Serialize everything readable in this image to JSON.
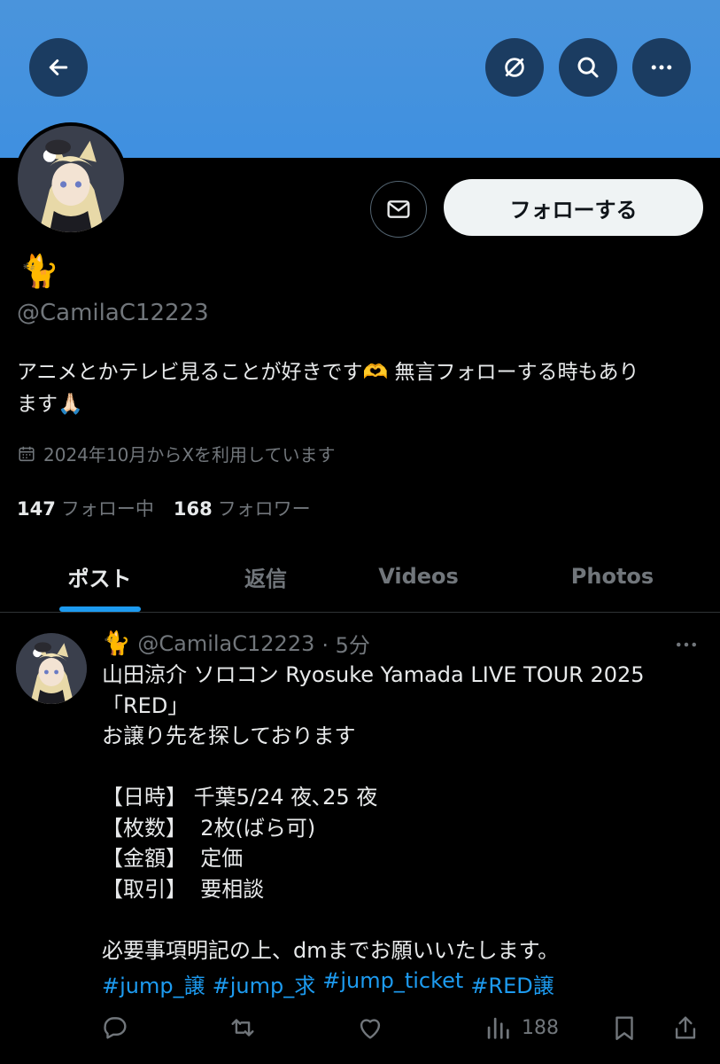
{
  "header": {
    "back_icon": "arrow-left-icon",
    "grok_icon": "slash-circle-icon",
    "search_icon": "search-icon",
    "more_icon": "more-horizontal-icon"
  },
  "profile": {
    "display_name_emoji": "🐈",
    "handle": "@CamilaC12223",
    "bio_line1": "アニメとかテレビ見ることが好きです🫶 無言フォローする時もあり",
    "bio_line2": "ます🙏🏻",
    "joined": "2024年10月からXを利用しています",
    "following_count": "147",
    "following_label": "フォロー中",
    "followers_count": "168",
    "followers_label": "フォロワー",
    "follow_button": "フォローする",
    "message_icon": "envelope-icon"
  },
  "tabs": [
    {
      "label": "ポスト",
      "active": true
    },
    {
      "label": "返信",
      "active": false
    },
    {
      "label": "Videos",
      "active": false
    },
    {
      "label": "Photos",
      "active": false
    }
  ],
  "post": {
    "author_emoji": "🐈",
    "handle": "@CamilaC12223",
    "time": "· 5分",
    "body": "山田涼介 ソロコン Ryosuke Yamada LIVE TOUR 2025\n「RED」\nお譲り先を探しております\n\n【日時】 千葉5/24 夜､25 夜\n【枚数】  2枚(ばら可)\n【金額】  定価\n【取引】  要相談\n\n必要事項明記の上、dmまでお願いいたします。",
    "hashtags": [
      "#jump_譲",
      "#jump_求",
      "#jump_ticket",
      "#RED譲"
    ],
    "views": "188"
  },
  "colors": {
    "banner": "#4a94dc",
    "accent": "#1d9bf0",
    "muted": "#71767b",
    "background": "#000000"
  }
}
